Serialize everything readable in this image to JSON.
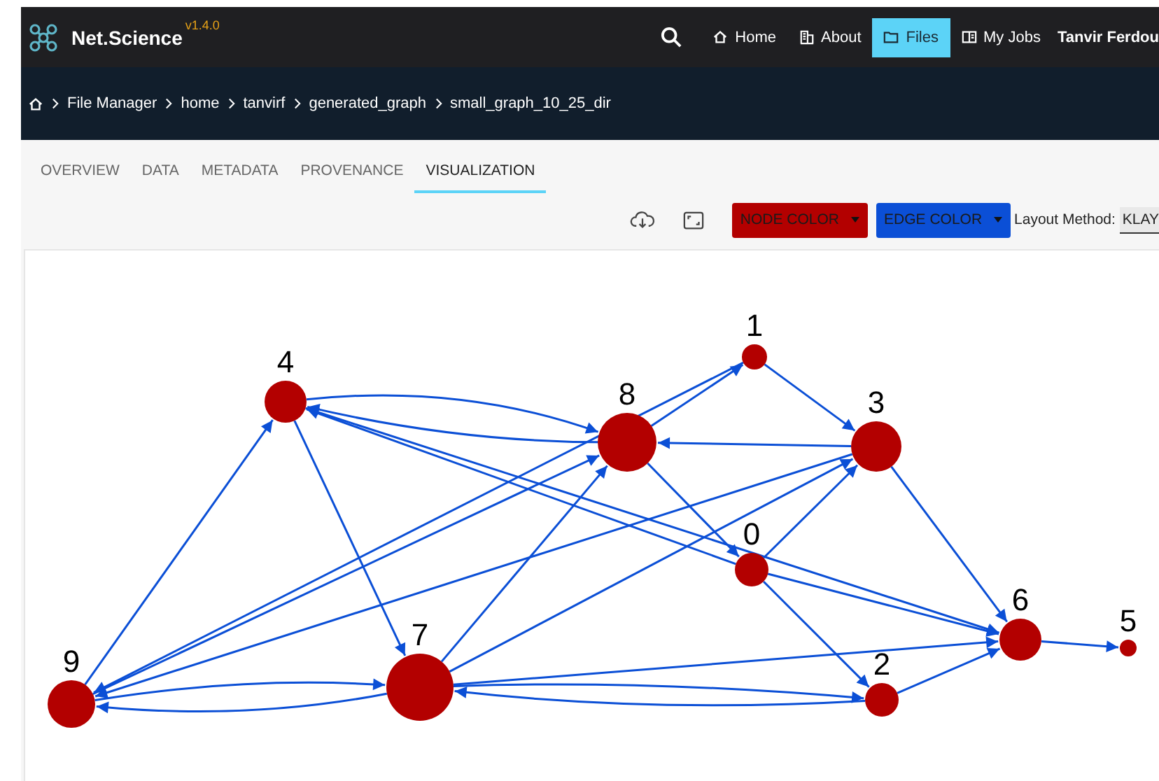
{
  "app": {
    "name": "Net.Science",
    "version": "v1.4.0"
  },
  "nav": [
    {
      "label": "Home",
      "kind": "home",
      "selected": false
    },
    {
      "label": "About",
      "kind": "about",
      "selected": false
    },
    {
      "label": "Files",
      "kind": "files",
      "selected": true
    },
    {
      "label": "My Jobs",
      "kind": "jobs",
      "selected": false
    }
  ],
  "user": "Tanvir Ferdou",
  "breadcrumb": [
    "File Manager",
    "home",
    "tanvirf",
    "generated_graph",
    "small_graph_10_25_dir"
  ],
  "tabs": [
    {
      "label": "OVERVIEW",
      "selected": false
    },
    {
      "label": "DATA",
      "selected": false
    },
    {
      "label": "METADATA",
      "selected": false
    },
    {
      "label": "PROVENANCE",
      "selected": false
    },
    {
      "label": "VISUALIZATION",
      "selected": true
    }
  ],
  "toolbar": {
    "node_color": {
      "label": "NODE COLOR",
      "color": "#b30000"
    },
    "edge_color": {
      "label": "EDGE COLOR",
      "color": "#0b4fd6"
    },
    "layout_label": "Layout Method:",
    "layout_value": "KLAY"
  },
  "graph": {
    "nodes": [
      "0",
      "1",
      "2",
      "3",
      "4",
      "5",
      "6",
      "7",
      "8",
      "9"
    ]
  }
}
